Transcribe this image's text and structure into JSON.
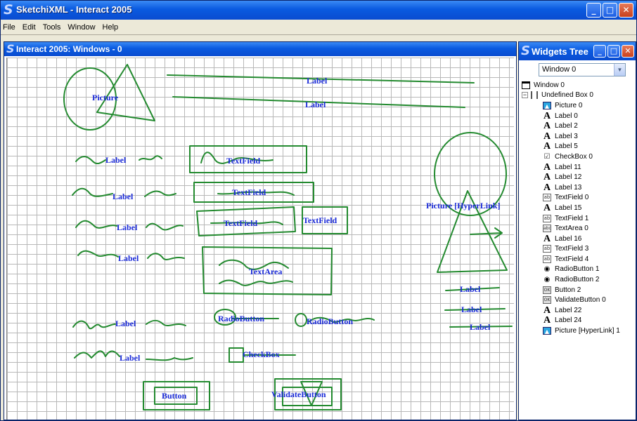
{
  "app": {
    "logo": "S",
    "title": "SketchiXML - Interact 2005",
    "buttons": {
      "minimize": "_",
      "maximize": "□",
      "close": "✕"
    }
  },
  "menu": [
    "File",
    "Edit",
    "Tools",
    "Window",
    "Help"
  ],
  "document": {
    "logo": "S",
    "title": "Interact 2005: Windows - 0"
  },
  "canvas": {
    "labels": {
      "picture": "Picture",
      "label_top1": "Label",
      "label_top2": "Label",
      "label_a": "Label",
      "label_b": "Label",
      "label_c": "Label",
      "label_d": "Label",
      "label_e": "Label",
      "label_f": "Label",
      "textfield_1": "TextField",
      "textfield_2": "TextField",
      "textfield_3": "TextField",
      "textfield_4": "TextField",
      "textarea": "TextArea",
      "radio_1": "RadioButton",
      "radio_2": "RadioButton",
      "checkbox": "CheckBox",
      "button": "Button",
      "validate_button": "ValidateButton",
      "picture_hyperlink": "Picture [HyperLink]",
      "label_r1": "Label",
      "label_r2": "Label",
      "label_r3": "Label"
    }
  },
  "widgets_tree": {
    "logo": "S",
    "title": "Widgets Tree",
    "buttons": {
      "minimize": "_",
      "maximize": "□",
      "close": "✕"
    },
    "combo_value": "Window 0",
    "items": [
      {
        "icon": "window-icon",
        "label": "Window 0"
      },
      {
        "icon": "box-icon",
        "label": "Undefined Box 0"
      },
      {
        "icon": "picture-icon",
        "label": "Picture 0"
      },
      {
        "icon": "label-icon",
        "label": "Label 0"
      },
      {
        "icon": "label-icon",
        "label": "Label 2"
      },
      {
        "icon": "label-icon",
        "label": "Label 3"
      },
      {
        "icon": "label-icon",
        "label": "Label 5"
      },
      {
        "icon": "checkbox-icon",
        "label": "CheckBox 0"
      },
      {
        "icon": "label-icon",
        "label": "Label 11"
      },
      {
        "icon": "label-icon",
        "label": "Label 12"
      },
      {
        "icon": "label-icon",
        "label": "Label 13"
      },
      {
        "icon": "textfield-icon",
        "label": "TextField 0"
      },
      {
        "icon": "label-icon",
        "label": "Label 15"
      },
      {
        "icon": "textfield-icon",
        "label": "TextField 1"
      },
      {
        "icon": "textarea-icon",
        "label": "TextArea 0"
      },
      {
        "icon": "label-icon",
        "label": "Label 16"
      },
      {
        "icon": "textfield-icon",
        "label": "TextField 3"
      },
      {
        "icon": "textfield-icon",
        "label": "TextField 4"
      },
      {
        "icon": "radio-icon",
        "label": "RadioButton 1"
      },
      {
        "icon": "radio-icon",
        "label": "RadioButton 2"
      },
      {
        "icon": "button-icon",
        "label": "Button 2"
      },
      {
        "icon": "button-icon",
        "label": "ValidateButton 0"
      },
      {
        "icon": "label-icon",
        "label": "Label 22"
      },
      {
        "icon": "label-icon",
        "label": "Label 24"
      },
      {
        "icon": "picture-icon",
        "label": "Picture [HyperLink] 1"
      }
    ]
  },
  "colors": {
    "sketch": "#238a2f",
    "label_text": "#1a2ad8",
    "titlebar": "#0a5ae0"
  }
}
